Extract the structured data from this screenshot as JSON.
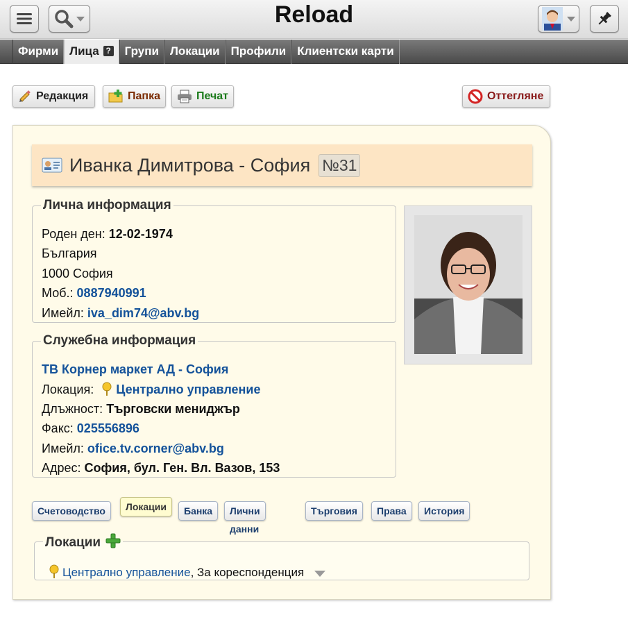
{
  "app": {
    "title": "Reload"
  },
  "topbar": {
    "menu_icon": "hamburger-icon",
    "search_icon": "magnifier-icon",
    "user_icon": "user-avatar",
    "pin_icon": "pushpin-icon"
  },
  "tabs": [
    {
      "label": "Фирми",
      "active": false
    },
    {
      "label": "Лица",
      "active": true,
      "help": "?"
    },
    {
      "label": "Групи",
      "active": false
    },
    {
      "label": "Локации",
      "active": false
    },
    {
      "label": "Профили",
      "active": false
    },
    {
      "label": "Клиентски карти",
      "active": false
    }
  ],
  "actions": {
    "edit": "Редакция",
    "folder": "Папка",
    "print": "Печат",
    "reject": "Оттегляне"
  },
  "person": {
    "name": "Иванка Димитрова - София",
    "number": "№31"
  },
  "personal": {
    "legend": "Лична информация",
    "birth_label": "Роден ден:",
    "birth_value": "12-02-1974",
    "country": "България",
    "city": "1000 София",
    "mobile_label": "Моб.:",
    "mobile_value": "0887940991",
    "email_label": "Имейл:",
    "email_value": "iva_dim74@abv.bg"
  },
  "work": {
    "legend": "Служебна информация",
    "company": "ТВ Корнер маркет АД - София",
    "location_label": "Локация:",
    "location_value": "Централно управление",
    "position_label": "Длъжност:",
    "position_value": "Търговски мениджър",
    "fax_label": "Факс:",
    "fax_value": "025556896",
    "email_label": "Имейл:",
    "email_value": "ofice.tv.corner@abv.bg",
    "address_label": "Адрес:",
    "address_value": "София, бул. Ген. Вл. Вазов, 153"
  },
  "sub_tabs": [
    {
      "label": "Счетоводство",
      "active": false
    },
    {
      "label": "Локации",
      "active": true
    },
    {
      "label": "Банка",
      "active": false
    },
    {
      "label": "Лични данни",
      "active": false
    },
    {
      "label": "Търговия",
      "active": false
    },
    {
      "label": "Права",
      "active": false
    },
    {
      "label": "История",
      "active": false
    }
  ],
  "locations": {
    "legend": "Локации",
    "item_link": "Централно управление",
    "item_suffix": ", За кореспонденция"
  },
  "colors": {
    "card_bg": "#fffbe9",
    "name_bar": "#fde5c4",
    "link": "#14529a",
    "folder_text": "#7a2a00",
    "print_text": "#1a7a1a",
    "reject_text": "#8a1a1a"
  }
}
